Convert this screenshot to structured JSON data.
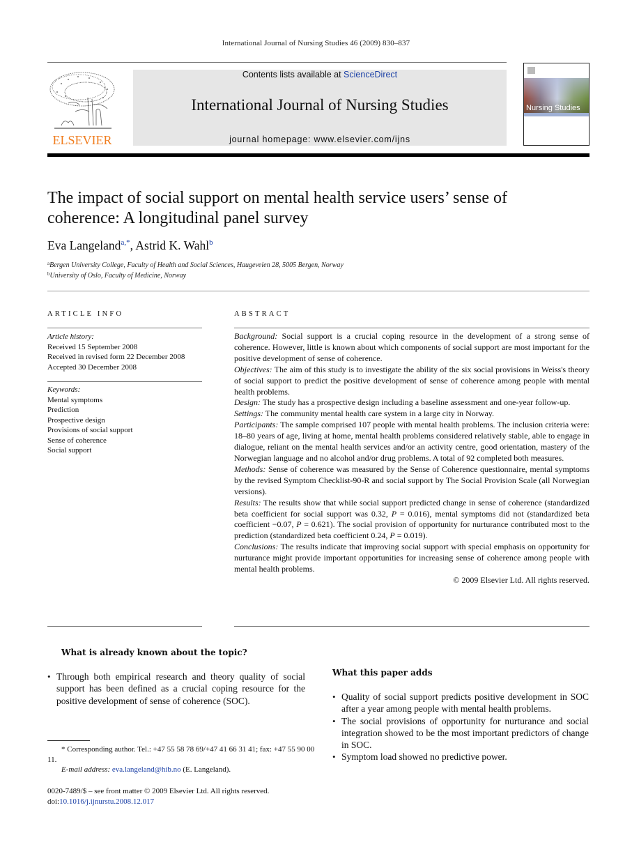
{
  "running_head": "International Journal of Nursing Studies 46 (2009) 830–837",
  "header": {
    "publisher_logo_text": "ELSEVIER",
    "contents_prefix": "Contents lists available at ",
    "contents_link": "ScienceDirect",
    "journal_name": "International Journal of Nursing Studies",
    "homepage": "journal homepage: www.elsevier.com/ijns",
    "cover_title": "Nursing Studies",
    "colors": {
      "publisher_orange": "#f07d1f",
      "link_blue": "#1a3fa6",
      "banner_grey": "#e6e6e6"
    }
  },
  "article": {
    "title_line1": "The impact of social support on mental health service users’ sense of",
    "title_line2": "coherence: A longitudinal panel survey",
    "authors": [
      {
        "name": "Eva Langeland",
        "sup": "a,*"
      },
      {
        "name": "Astrid K. Wahl",
        "sup": "b"
      }
    ],
    "author_separator": ", ",
    "affiliations": [
      {
        "sup": "a",
        "text": "Bergen University College, Faculty of Health and Social Sciences, Haugeveien 28, 5005 Bergen, Norway"
      },
      {
        "sup": "b",
        "text": "University of Oslo, Faculty of Medicine, Norway"
      }
    ]
  },
  "article_info": {
    "heading": "ARTICLE INFO",
    "history_label": "Article history:",
    "history": [
      "Received 15 September 2008",
      "Received in revised form 22 December 2008",
      "Accepted 30 December 2008"
    ],
    "keywords_label": "Keywords:",
    "keywords": [
      "Mental symptoms",
      "Prediction",
      "Prospective design",
      "Provisions of social support",
      "Sense of coherence",
      "Social support"
    ]
  },
  "abstract": {
    "heading": "ABSTRACT",
    "sections": [
      {
        "label": "Background:",
        "text": " Social support is a crucial coping resource in the development of a strong sense of coherence. However, little is known about which components of social support are most important for the positive development of sense of coherence."
      },
      {
        "label": "Objectives:",
        "text": " The aim of this study is to investigate the ability of the six social provisions in Weiss's theory of social support to predict the positive development of sense of coherence among people with mental health problems."
      },
      {
        "label": "Design:",
        "text": " The study has a prospective design including a baseline assessment and one-year follow-up."
      },
      {
        "label": "Settings:",
        "text": " The community mental health care system in a large city in Norway."
      },
      {
        "label": "Participants:",
        "text": " The sample comprised 107 people with mental health problems. The inclusion criteria were: 18–80 years of age, living at home, mental health problems considered relatively stable, able to engage in dialogue, reliant on the mental health services and/or an activity centre, good orientation, mastery of the Norwegian language and no alcohol and/or drug problems. A total of 92 completed both measures."
      },
      {
        "label": "Methods:",
        "text": " Sense of coherence was measured by the Sense of Coherence questionnaire, mental symptoms by the revised Symptom Checklist-90-R and social support by The Social Provision Scale (all Norwegian versions)."
      }
    ],
    "results": {
      "label": "Results:",
      "part1": " The results show that while social support predicted change in sense of coherence (standardized beta coefficient for social support was 0.32, ",
      "p1": "P",
      "part2": " = 0.016), mental symptoms did not (standardized beta coefficient −0.07, ",
      "p2": "P",
      "part3": " = 0.621). The social provision of opportunity for nurturance contributed most to the prediction (standardized beta coefficient 0.24, ",
      "p3": "P",
      "part4": " = 0.019)."
    },
    "conclusions": {
      "label": "Conclusions:",
      "text": " The results indicate that improving social support with special emphasis on opportunity for nurturance might provide important opportunities for increasing sense of coherence among people with mental health problems."
    },
    "copyright": "© 2009 Elsevier Ltd. All rights reserved."
  },
  "known_box": {
    "heading": "What is already known about the topic?",
    "bullets": [
      "Through both empirical research and theory quality of social support has been defined as a crucial coping resource for the positive development of sense of coherence (SOC)."
    ]
  },
  "adds_box": {
    "heading": "What this paper adds",
    "bullets": [
      "Quality of social support predicts positive development in SOC after a year among people with mental health problems.",
      "The social provisions of opportunity for nurturance and social integration showed to be the most important predictors of change in SOC.",
      "Symptom load showed no predictive power."
    ]
  },
  "footnotes": {
    "corresponding_mark": "*",
    "corresponding_text": " Corresponding author. Tel.: +47 55 58 78 69/+47 41 66 31 41; fax: +47 55 90 00 11.",
    "email_label": "E-mail address:",
    "email": "eva.langeland@hib.no",
    "email_owner": " (E. Langeland).",
    "front_matter": "0020-7489/$ – see front matter © 2009 Elsevier Ltd. All rights reserved.",
    "doi_prefix": "doi:",
    "doi": "10.1016/j.ijnurstu.2008.12.017"
  }
}
